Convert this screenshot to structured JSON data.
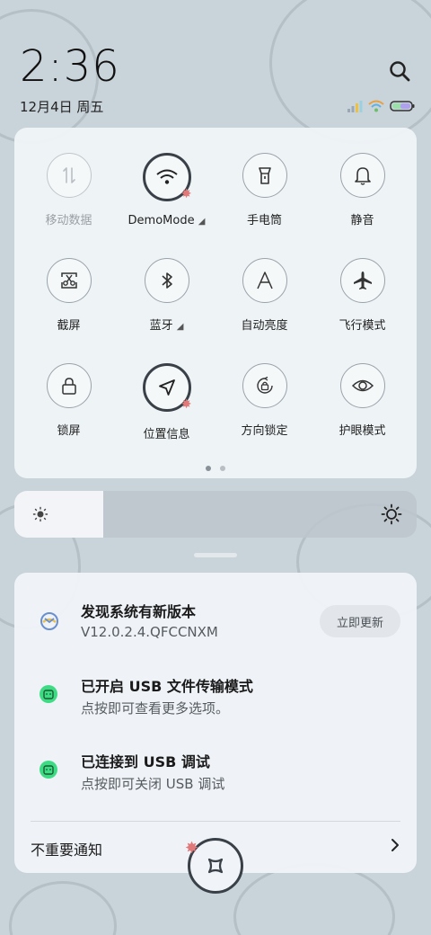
{
  "status_bar": {
    "time": "2:36",
    "date": "12月4日 周五"
  },
  "icons": {
    "search": "search-icon",
    "signal": "signal-icon",
    "wifi": "wifi-icon",
    "battery": "battery-icon"
  },
  "quick_settings": {
    "tiles": [
      {
        "label": "移动数据",
        "icon": "mobile-data-icon",
        "state": "disabled"
      },
      {
        "label": "DemoMode",
        "icon": "wifi-icon",
        "state": "active",
        "expand": "◢"
      },
      {
        "label": "手电筒",
        "icon": "flashlight-icon",
        "state": "off"
      },
      {
        "label": "静音",
        "icon": "bell-icon",
        "state": "off"
      },
      {
        "label": "截屏",
        "icon": "screenshot-icon",
        "state": "off"
      },
      {
        "label": "蓝牙",
        "icon": "bluetooth-icon",
        "state": "off",
        "expand": "◢"
      },
      {
        "label": "自动亮度",
        "icon": "auto-brightness-icon",
        "state": "off"
      },
      {
        "label": "飞行模式",
        "icon": "airplane-icon",
        "state": "off"
      },
      {
        "label": "锁屏",
        "icon": "lock-icon",
        "state": "off"
      },
      {
        "label": "位置信息",
        "icon": "location-icon",
        "state": "active"
      },
      {
        "label": "方向锁定",
        "icon": "rotation-lock-icon",
        "state": "off"
      },
      {
        "label": "护眼模式",
        "icon": "eye-icon",
        "state": "off"
      }
    ],
    "page": 1,
    "page_count": 2
  },
  "brightness": {
    "level": 0.22
  },
  "notifications": [
    {
      "title": "发现系统有新版本",
      "subtitle": "V12.0.2.4.QFCCNXM",
      "action": "立即更新",
      "icon": "update-icon"
    },
    {
      "title": "已开启 USB 文件传输模式",
      "subtitle": "点按即可查看更多选项。",
      "icon": "android-icon"
    },
    {
      "title": "已连接到 USB 调试",
      "subtitle": "点按即可关闭 USB 调试",
      "icon": "android-icon"
    }
  ],
  "minor_notifications": {
    "label": "不重要通知"
  },
  "colors": {
    "accent_star": "#e07a7a",
    "active_ring": "#3a4048",
    "android_green": "#3ddc84"
  }
}
